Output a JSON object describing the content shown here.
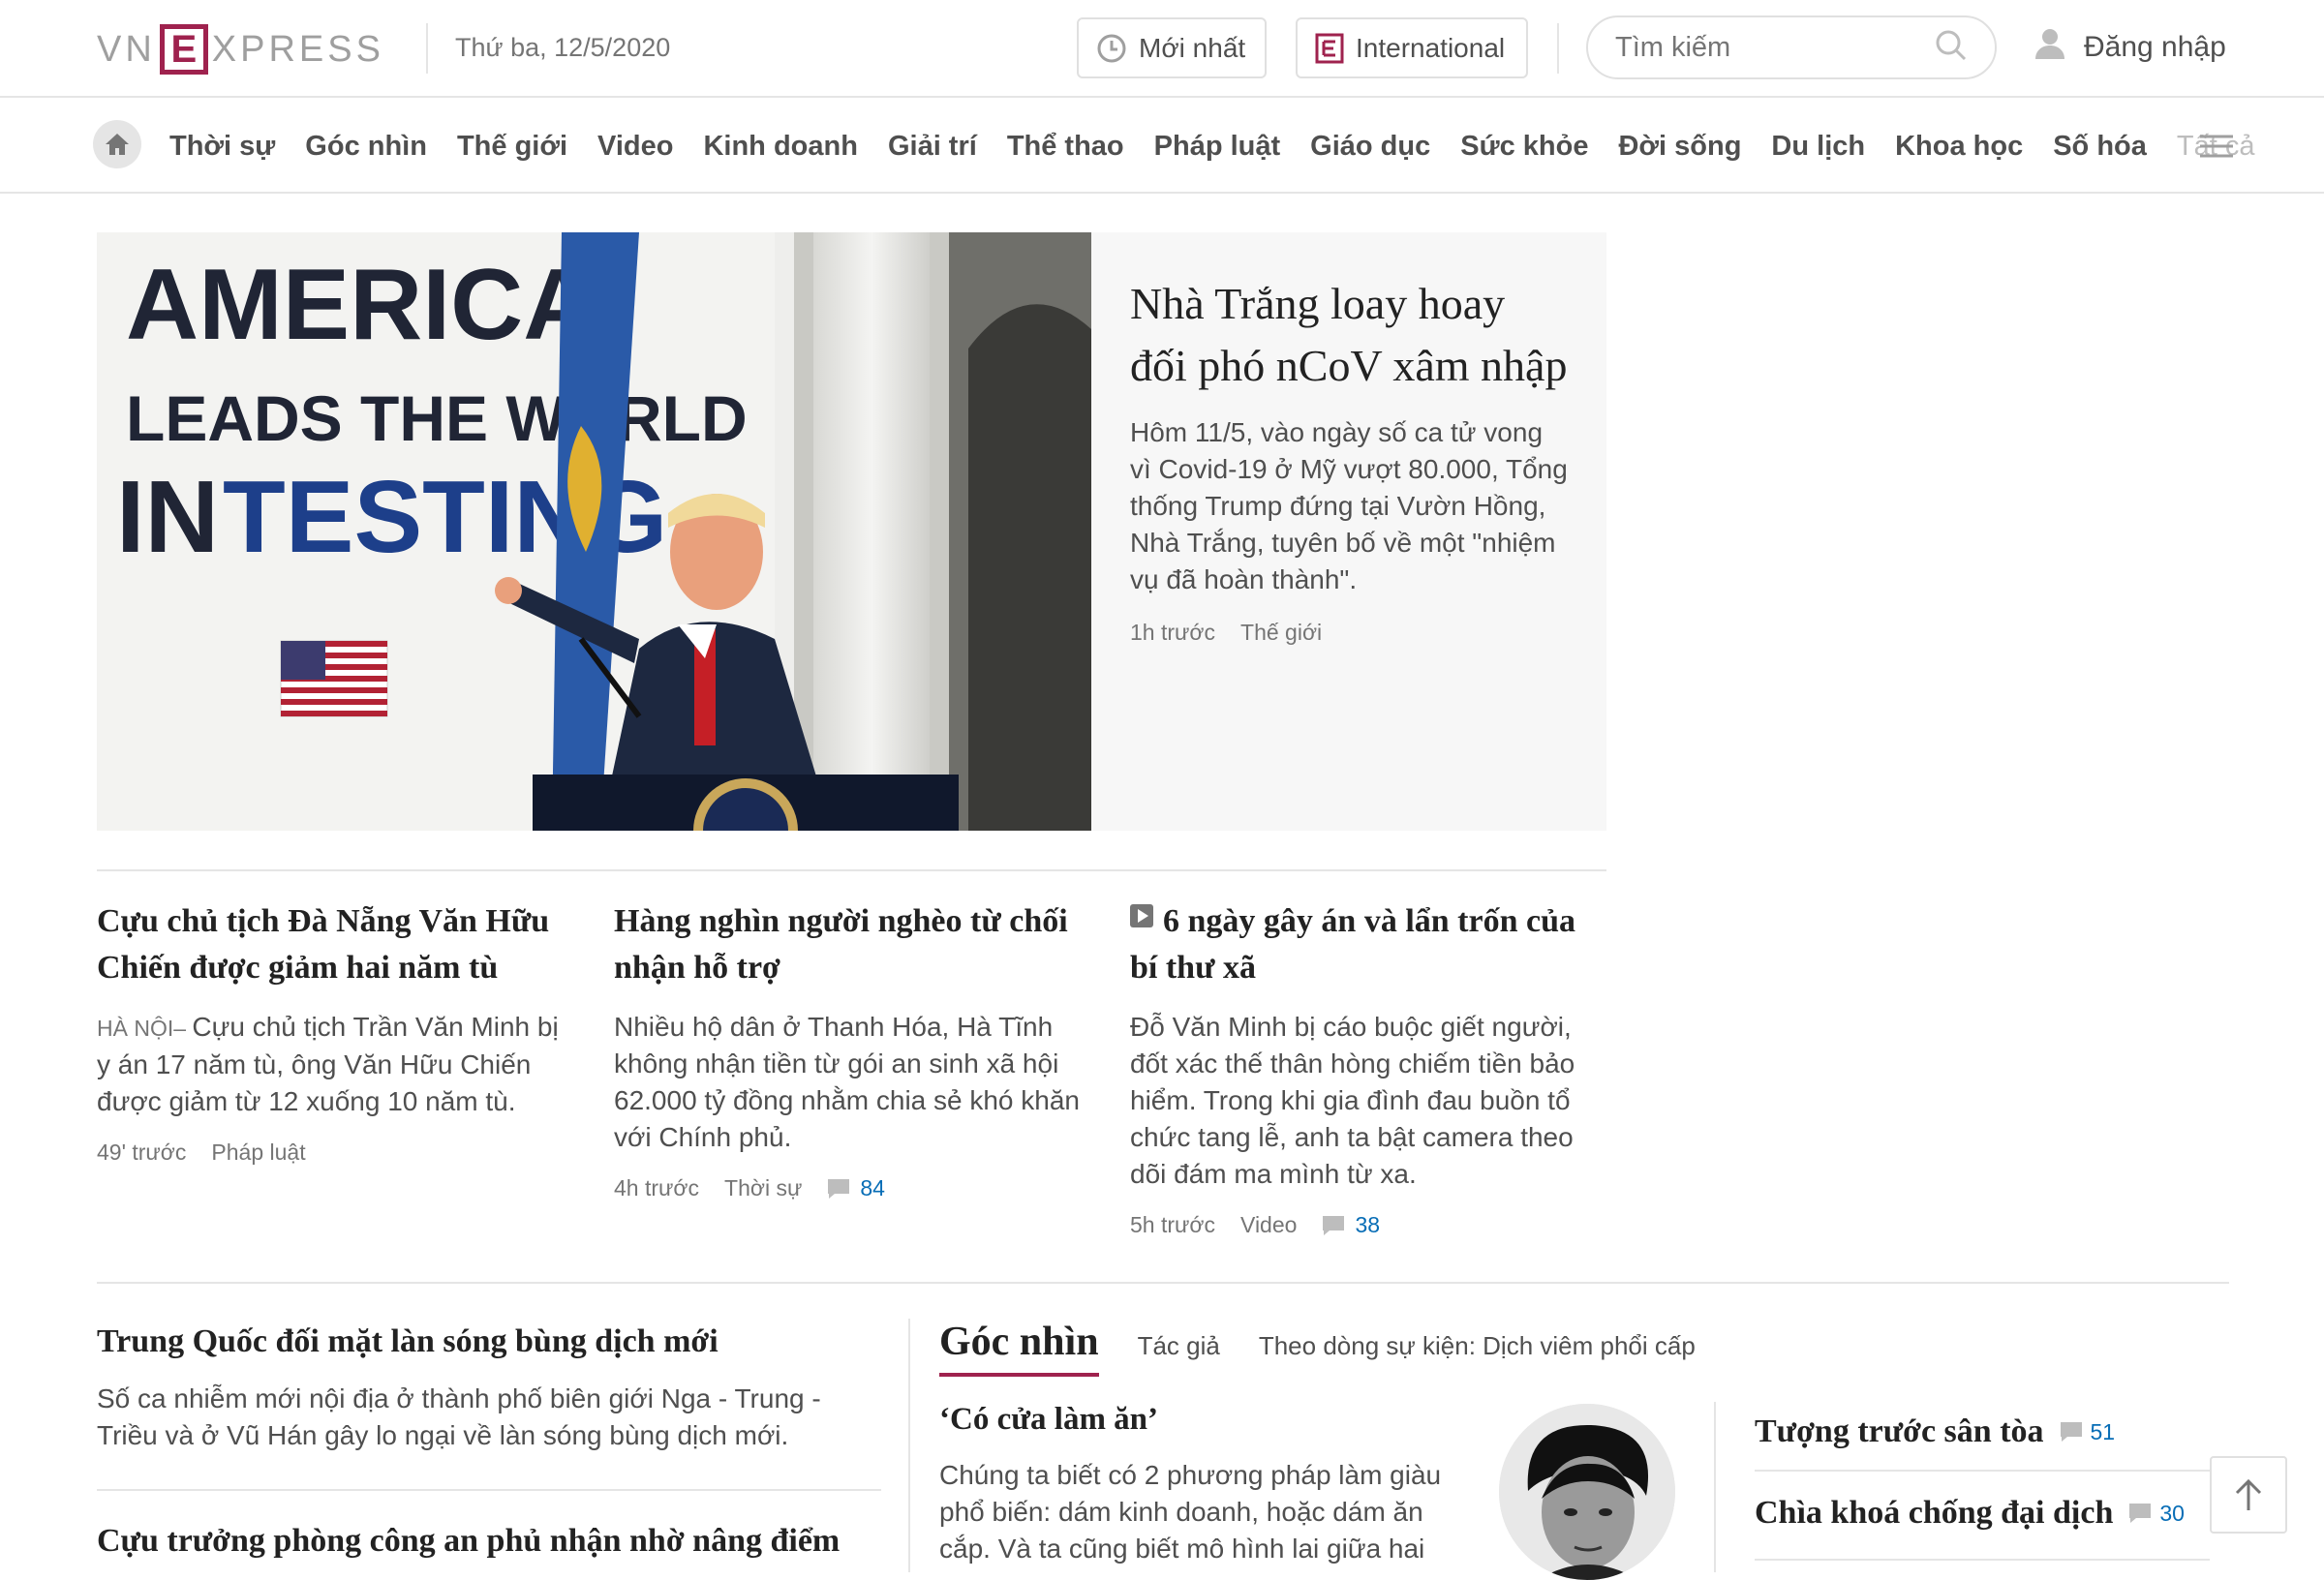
{
  "header": {
    "logo": {
      "left": "VN",
      "mid": "E",
      "right": "XPRESS"
    },
    "date": "Thứ ba, 12/5/2020",
    "latest_label": "Mới nhất",
    "international_label": "International",
    "search_placeholder": "Tìm kiếm",
    "login_label": "Đăng nhập"
  },
  "nav": {
    "items": [
      "Thời sự",
      "Góc nhìn",
      "Thế giới",
      "Video",
      "Kinh doanh",
      "Giải trí",
      "Thể thao",
      "Pháp luật",
      "Giáo dục",
      "Sức khỏe",
      "Đời sống",
      "Du lịch",
      "Khoa học",
      "Số hóa"
    ],
    "all_label": "Tất cả"
  },
  "hero": {
    "image_sign": {
      "line1": "AMERICA",
      "line2": "LEADS THE WORLD",
      "line3a": "IN ",
      "line3b": "TESTING"
    },
    "title": "Nhà Trắng loay hoay đối phó nCoV xâm nhập",
    "desc": "Hôm 11/5, vào ngày số ca tử vong vì Covid-19 ở Mỹ vượt 80.000, Tổng thống Trump đứng tại Vườn Hồng, Nhà Trắng, tuyên bố về một \"nhiệm vụ đã hoàn thành\".",
    "time": "1h trước",
    "category": "Thế giới"
  },
  "articles": [
    {
      "title": "Cựu chủ tịch Đà Nẵng Văn Hữu Chiến được giảm hai năm tù",
      "location": "HÀ NỘI– ",
      "desc": "Cựu chủ tịch Trần Văn Minh bị y án 17 năm tù, ông Văn Hữu Chiến được giảm từ 12 xuống 10 năm tù.",
      "time": "49' trước",
      "category": "Pháp luật"
    },
    {
      "title": "Hàng nghìn người nghèo từ chối nhận hỗ trợ",
      "desc": "Nhiều hộ dân ở Thanh Hóa, Hà Tĩnh không nhận tiền từ gói an sinh xã hội 62.000 tỷ đồng nhằm chia sẻ khó khăn với Chính phủ.",
      "time": "4h trước",
      "category": "Thời sự",
      "comments": "84"
    },
    {
      "title": "6 ngày gây án và lẩn trốn của bí thư xã",
      "desc": "Đỗ Văn Minh bị cáo buộc giết người, đốt xác thế thân hòng chiếm tiền bảo hiểm. Trong khi gia đình đau buồn tổ chức tang lễ, anh ta bật camera theo dõi đám ma mình từ xa.",
      "time": "5h trước",
      "category": "Video",
      "comments": "38"
    }
  ],
  "bottom_left": [
    {
      "title": "Trung Quốc đối mặt làn sóng bùng dịch mới",
      "desc": "Số ca nhiễm mới nội địa ở thành phố biên giới Nga - Trung - Triều và ở Vũ Hán gây lo ngại về làn sóng bùng dịch mới."
    },
    {
      "title": "Cựu trưởng phòng công an phủ nhận nhờ nâng điểm"
    }
  ],
  "goc_nhin": {
    "title": "Góc nhìn",
    "tab_author": "Tác giả",
    "tab_event": "Theo dòng sự kiện: Dịch viêm phổi cấp",
    "article_title": "‘Có cửa làm ăn’",
    "article_desc": "Chúng ta biết có 2 phương pháp làm giàu phổ biến: dám kinh doanh, hoặc dám ăn cắp. Và ta cũng biết mô hình lai giữa hai"
  },
  "side_list": [
    {
      "title": "Tượng trước sân tòa",
      "comments": "51"
    },
    {
      "title": "Chìa khoá chống đại dịch",
      "comments": "30"
    }
  ],
  "colors": {
    "brand": "#9f224e",
    "link": "#076db6",
    "text": "#222222",
    "muted": "#757575"
  }
}
